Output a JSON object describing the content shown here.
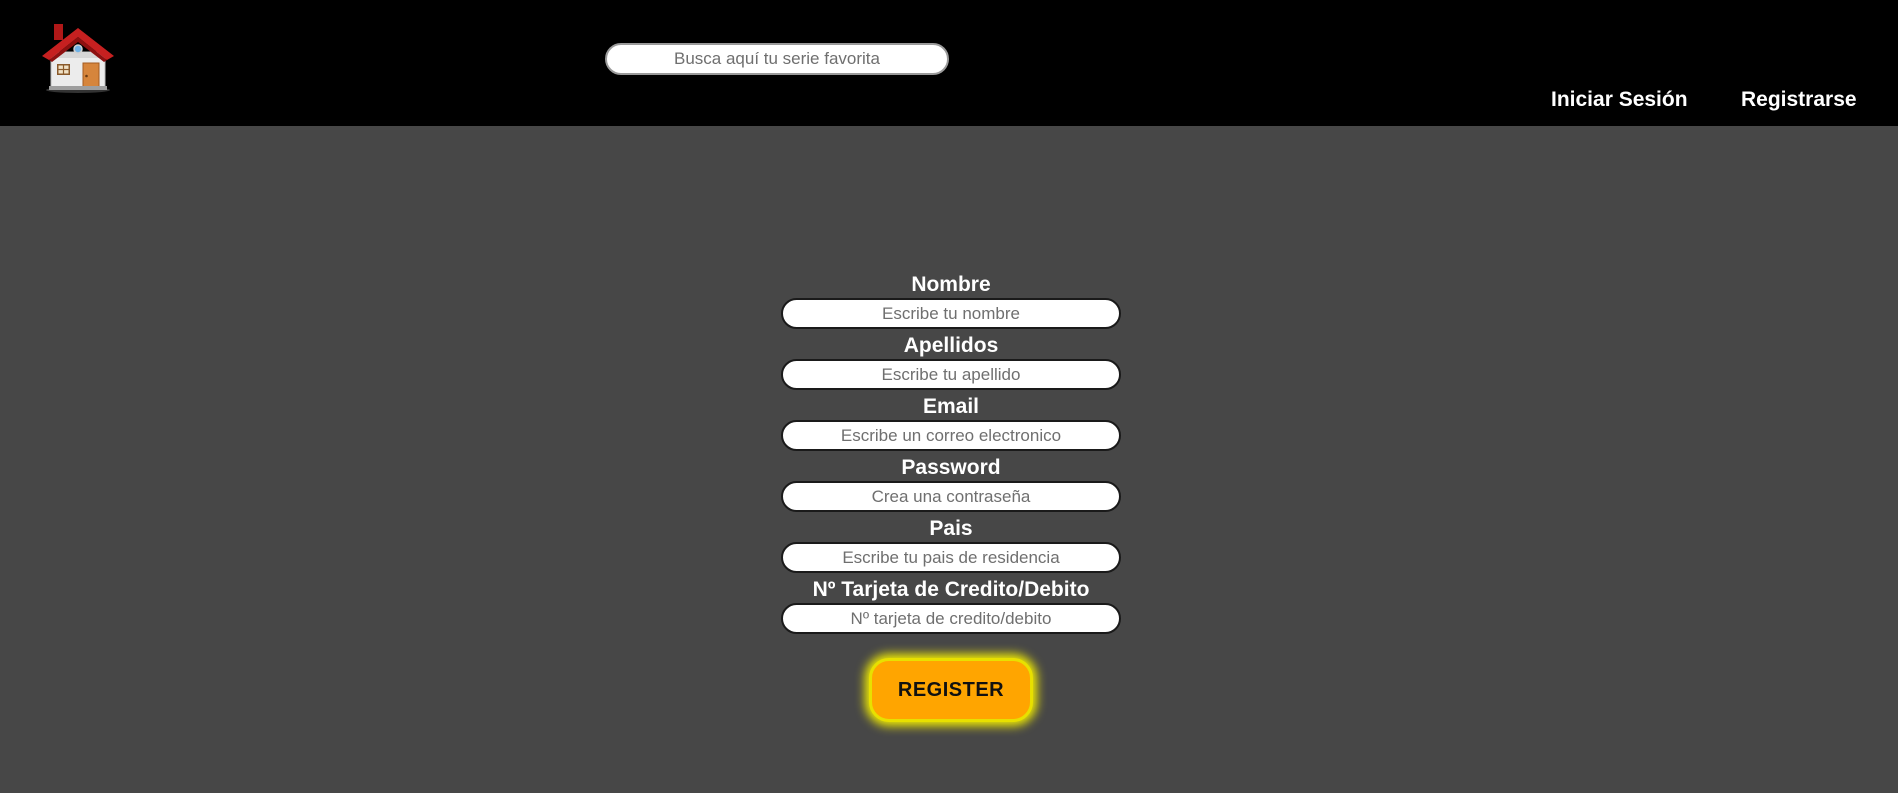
{
  "header": {
    "home_icon": "house-icon",
    "search": {
      "placeholder": "Busca aquí tu serie favorita",
      "value": ""
    },
    "nav": {
      "login_label": "Iniciar Sesión",
      "register_label": "Registrarse"
    }
  },
  "form": {
    "fields": [
      {
        "label": "Nombre",
        "placeholder": "Escribe tu nombre"
      },
      {
        "label": "Apellidos",
        "placeholder": "Escribe tu apellido"
      },
      {
        "label": "Email",
        "placeholder": "Escribe un correo electronico"
      },
      {
        "label": "Password",
        "placeholder": "Crea una contraseña"
      },
      {
        "label": "Pais",
        "placeholder": "Escribe tu pais de residencia"
      },
      {
        "label": "Nº Tarjeta de Credito/Debito",
        "placeholder": "Nº tarjeta de credito/debito"
      }
    ],
    "submit_label": "REGISTER"
  },
  "colors": {
    "header_bg": "#000000",
    "page_bg": "#474747",
    "button_bg": "#ffa500",
    "button_glow": "#f3ee00"
  }
}
